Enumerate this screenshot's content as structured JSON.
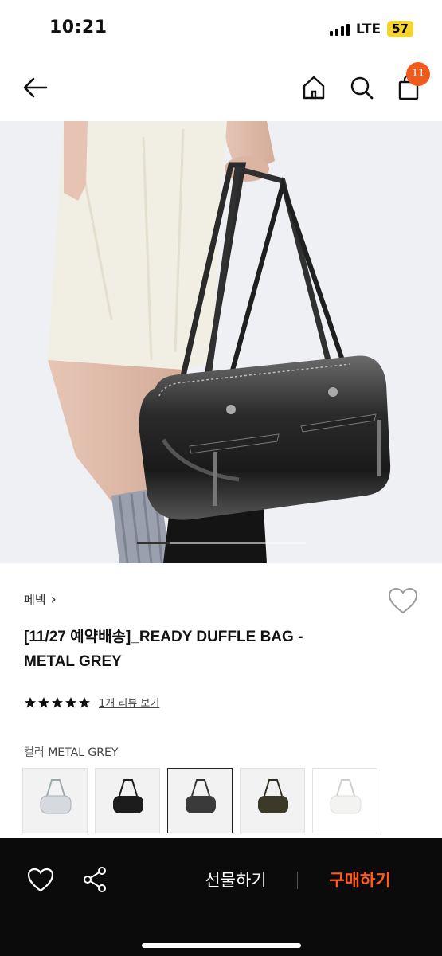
{
  "status_bar": {
    "time": "10:21",
    "network": "LTE",
    "battery": "57"
  },
  "header": {
    "cart_count": "11",
    "icons": [
      "back-arrow-icon",
      "home-icon",
      "search-icon",
      "shopping-bag-icon"
    ]
  },
  "hero": {
    "slide_progress": 0.2
  },
  "product": {
    "brand": "페넥",
    "brand_chevron": "›",
    "title_line1": "[11/27 예약배송]_READY DUFFLE BAG -",
    "title_line2": "METAL GREY",
    "rating_stars": 5,
    "review_link": "1개 리뷰 보기"
  },
  "options": {
    "color_label": "컬러",
    "color_value": "METAL GREY",
    "swatches": [
      {
        "name": "clear",
        "bag_color": "#c9cdd2"
      },
      {
        "name": "black",
        "bag_color": "#1c1c1c"
      },
      {
        "name": "metal-grey",
        "bag_color": "#3a3a3a",
        "selected": true
      },
      {
        "name": "khaki",
        "bag_color": "#3b3a28"
      },
      {
        "name": "white",
        "bag_color": "#f3f3f1"
      }
    ]
  },
  "bottom_bar": {
    "gift_label": "선물하기",
    "buy_label": "구매하기"
  },
  "colors": {
    "accent": "#ff5a1f",
    "badge": "#f05a1a",
    "bottom_bg": "#0b0b0b"
  }
}
